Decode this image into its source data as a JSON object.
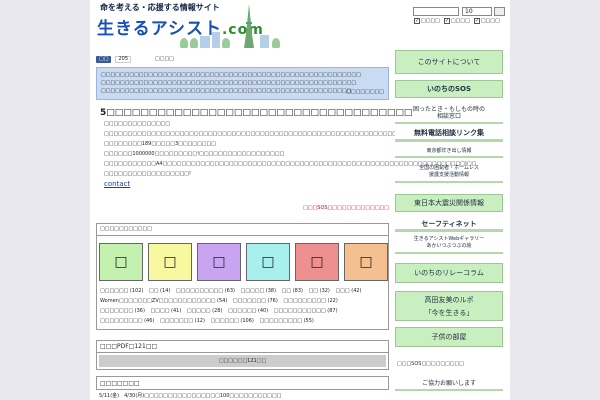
{
  "header": {
    "tagline": "命を考える・応援する情報サイト",
    "logo_main": "生きるアシスト",
    "logo_dotcom": ".com",
    "search_select_value": "10",
    "checks": [
      "□□□□",
      "□□□□",
      "□□□□"
    ]
  },
  "like": {
    "label": "□□",
    "count": "205",
    "share": "□□□□"
  },
  "notice": {
    "lines": [
      "□□□□□□□□□□□□□□□□□□□□□□□□□□□□□□□□□□□□□□□□□□□□□□□□□□□□□□□",
      "□□□□□□□□□□□□□□□□□□□□□□□□□□□□□□□□□□□□□□□□□□□□□□□□□□□□□□",
      "□□□□□□□□□□□□□□□□□□□□□□□□□□□□□□□□□□□□□□□□□□□□□□□□□□□□□"
    ],
    "link": "□□□□□□□□"
  },
  "article": {
    "title": "5□□□□□□□□□□□□□□□□□□□□□□□□□□□□□□□□□□□□",
    "lines": [
      "□□□□□□□□□□□□□□",
      "□□□□□□□□□□□□□□□□□□□□□□□□□□□□□□□□□□□□□□□□□□□□□□□□□□□□□□□□□□□□□□□□□□□□□",
      "□□□□□□□□189□□□□□3□□□□□□□□",
      "□□□□□□1000000□□□□□□□□□!□□□□□□□□□□□□□□□□□□",
      "□□□□□□□□□□□A4□□□□□□□□□□□□□□□□□□□□□□□□□□□□□□□□□□□□□□□□□□□□□□□□□□□□□□□□□□□□□□□□)□□",
      "□□□□□□□□□□□□□□□□□□!"
    ],
    "contact": "contact",
    "sos_link": "□□□SOS□□□□□□□□□□□□□"
  },
  "categories": {
    "heading": "□□□□□□□□□□□",
    "swatches": [
      {
        "glyph": "□",
        "color": "#c4f0b0"
      },
      {
        "glyph": "□",
        "color": "#f8f8a0"
      },
      {
        "glyph": "□",
        "color": "#c9a4f0"
      },
      {
        "glyph": "□",
        "color": "#a8f0ee"
      },
      {
        "glyph": "□",
        "color": "#ee9090"
      },
      {
        "glyph": "□",
        "color": "#f5c090"
      }
    ],
    "tags": [
      "□□□□□□ (102)",
      "□□ (14)",
      "□□□□□□□□□□ (63)",
      "□□□□□ (38)",
      "□□ (83)",
      "□□ (32)",
      "□□□ (42)",
      "Women□□□□□□□ZV□□□□□□□□□□□□ (54)",
      "□□□□□□□ (76)",
      "□□□□□□□□□ (22)",
      "□□□□□□□ (36)",
      "□□□□ (41)",
      "□□□□□ (28)",
      "□□□□□□ (40)",
      "□□□□□□□□□□□ (87)",
      "□□□□□□□□□ (46)",
      "□□□□□□□ (12)",
      "□□□□□□ (106)",
      "□□□□□□□□□ (55)"
    ]
  },
  "pdf": {
    "heading": "□□□PDF□121□□",
    "button": "□□□□□□121□□"
  },
  "update": {
    "heading": "□□□□□□□",
    "text": "5/11(金)　4/30(月)□□□□□□□□□□□□□□□□100□□□□□□□□□□□"
  },
  "sidebar": {
    "about": "このサイトについて",
    "sos": "いのちのSOS",
    "trouble": [
      "困ったとき・もしもの時の",
      "相談窓口"
    ],
    "free_call": "無料電話相談リンク集",
    "tokyo": "東京都炊き出し情報",
    "homeless": [
      "全国の困窮者・ホームレス",
      "援護支援活動情報"
    ],
    "quake": "東日本大震災関係情報",
    "safety_net": "セーフティネット",
    "gallery": [
      "生きるアシストWebギャラリー",
      "あかいつぶつぶの絵"
    ],
    "relay": "いのちのリレーコラム",
    "report": [
      "高田友美のルポ",
      "「今を生きる」"
    ],
    "kids": "子供の部屋",
    "sos_note": "□□□SOS□□□□□□□□□",
    "donate": "ご協力お願いします"
  }
}
